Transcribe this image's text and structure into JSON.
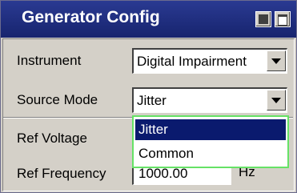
{
  "window": {
    "title": "Generator Config",
    "title_bar_color": "#1c2a7c"
  },
  "fields": {
    "instrument": {
      "label": "Instrument",
      "value": "Digital Impairment"
    },
    "source_mode": {
      "label": "Source Mode",
      "value": "Jitter"
    },
    "ref_voltage": {
      "label": "Ref Voltage"
    },
    "ref_frequency": {
      "label": "Ref Frequency",
      "value": "1000.00",
      "unit": "Hz"
    }
  },
  "source_mode_dropdown": {
    "options": [
      "Jitter",
      "Common"
    ],
    "selected_index": 0,
    "highlight_color": "#0a1a6e",
    "border_color": "#66e266"
  },
  "icons": {
    "minimize": "minimize-icon",
    "restore": "restore-icon",
    "dropdown": "chevron-down-icon"
  }
}
